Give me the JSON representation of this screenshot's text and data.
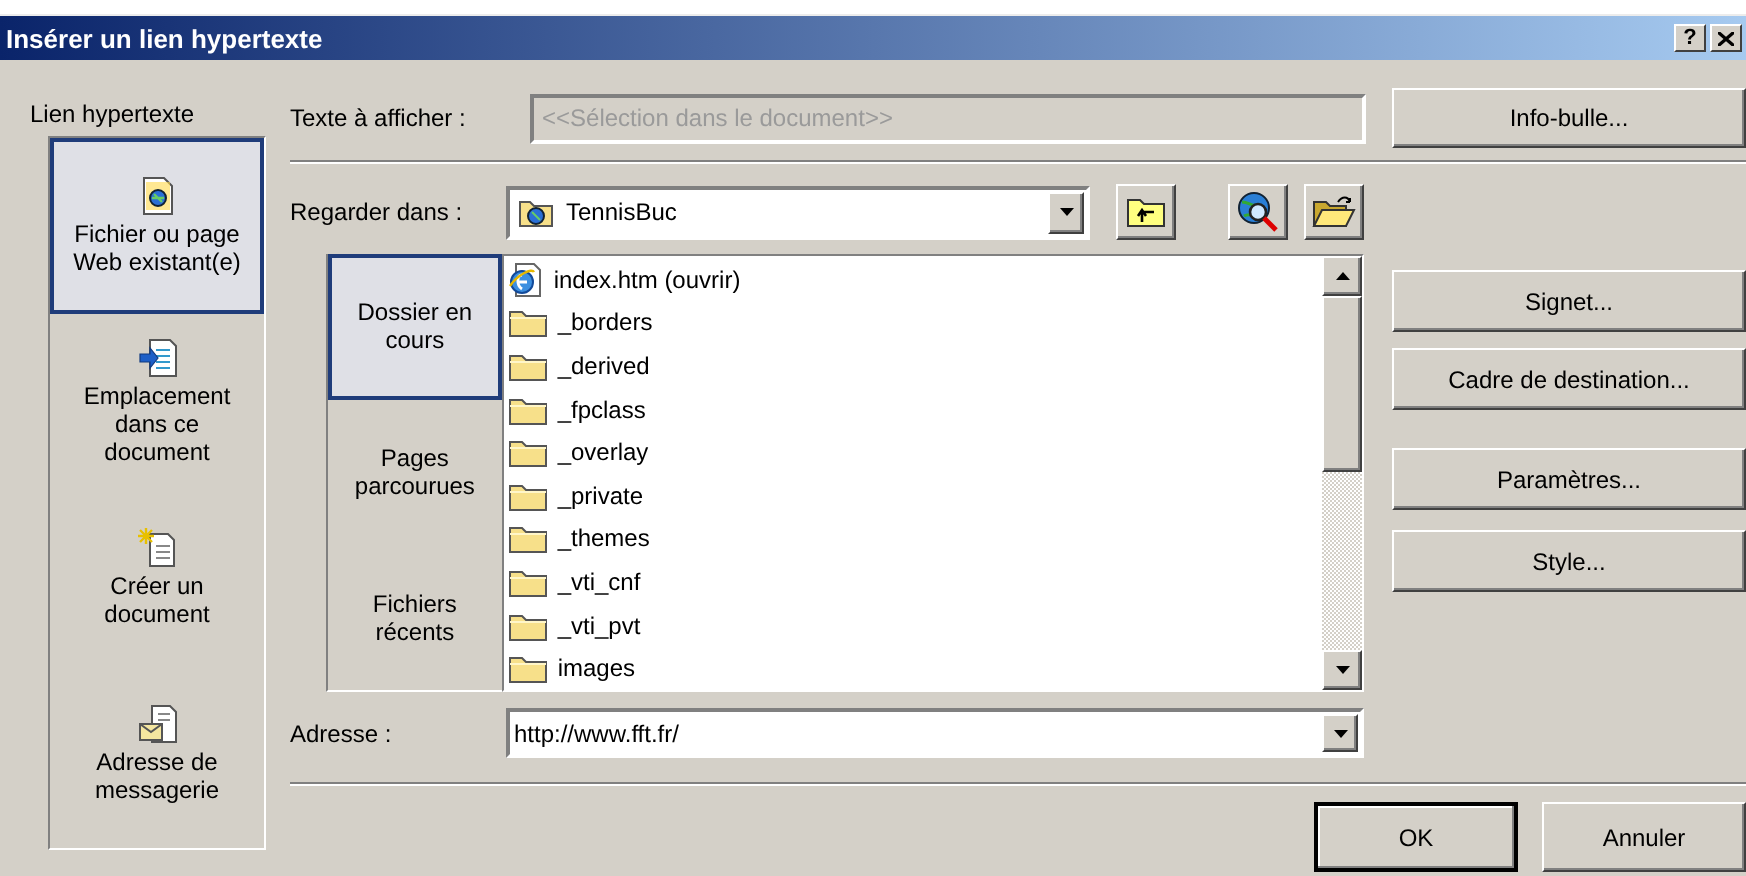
{
  "window": {
    "title": "Insérer un lien hypertexte",
    "help_button": "?"
  },
  "link_to": {
    "label": "Lien hypertexte",
    "items": [
      {
        "kind": "file",
        "label": "Fichier ou page Web existant(e)",
        "selected": true
      },
      {
        "kind": "place",
        "label": "Emplacement dans ce document",
        "selected": false
      },
      {
        "kind": "new",
        "label": "Créer un document",
        "selected": false
      },
      {
        "kind": "email",
        "label": "Adresse de messagerie",
        "selected": false
      }
    ]
  },
  "display_text": {
    "label": "Texte à afficher :",
    "placeholder": "<<Sélection dans le document>>",
    "disabled": true
  },
  "tooltip_button": "Info-bulle...",
  "look_in": {
    "label": "Regarder dans :",
    "value": "TennisBuc"
  },
  "sources": [
    {
      "label": "Dossier en cours",
      "selected": true
    },
    {
      "label": "Pages parcourues",
      "selected": false
    },
    {
      "label": "Fichiers récents",
      "selected": false
    }
  ],
  "files": [
    {
      "kind": "page",
      "name": "index.htm (ouvrir)"
    },
    {
      "kind": "folder",
      "name": "_borders"
    },
    {
      "kind": "folder",
      "name": "_derived"
    },
    {
      "kind": "folder",
      "name": "_fpclass"
    },
    {
      "kind": "folder",
      "name": "_overlay"
    },
    {
      "kind": "folder",
      "name": "_private"
    },
    {
      "kind": "folder",
      "name": "_themes"
    },
    {
      "kind": "folder",
      "name": "_vti_cnf"
    },
    {
      "kind": "folder",
      "name": "_vti_pvt"
    },
    {
      "kind": "folder",
      "name": "images"
    }
  ],
  "side_buttons": [
    "Signet...",
    "Cadre de destination...",
    "Paramètres...",
    "Style..."
  ],
  "address": {
    "label": "Adresse :",
    "value": "http://www.fft.fr/"
  },
  "buttons": [
    {
      "label": "OK",
      "default": true
    },
    {
      "label": "Annuler",
      "default": false
    }
  ]
}
